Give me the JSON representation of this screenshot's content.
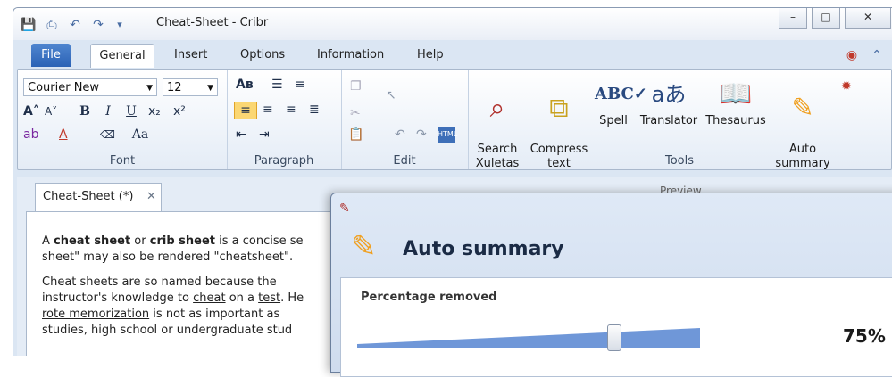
{
  "window": {
    "title": "Cheat-Sheet - Cribr"
  },
  "quick_access": [
    "save-icon",
    "print-icon",
    "undo-icon",
    "redo-icon",
    "customize-icon"
  ],
  "ribbon_tabs": {
    "file": "File",
    "general": "General",
    "insert": "Insert",
    "options": "Options",
    "information": "Information",
    "help": "Help"
  },
  "ribbon": {
    "font": {
      "family": "Courier New",
      "size": "12",
      "label": "Font",
      "bold": "B",
      "italic": "I",
      "underline": "U",
      "case": "Aa"
    },
    "paragraph": {
      "label": "Paragraph"
    },
    "edit": {
      "label": "Edit"
    },
    "tools": {
      "label": "Tools",
      "search_xuletas": "Search\nXuletas",
      "compress_text": "Compress\ntext",
      "spell": "Spell",
      "translator": "Translator",
      "thesaurus": "Thesaurus",
      "auto_summary": "Auto\nsummary"
    }
  },
  "document_tab": {
    "label": "Cheat-Sheet (*)"
  },
  "preview": {
    "label": "Preview"
  },
  "document": {
    "p1_a": "A ",
    "p1_b": "cheat sheet",
    "p1_c": " or ",
    "p1_d": "crib sheet",
    "p1_e": " is a concise se",
    "p1_line2": "sheet\" may also be rendered \"cheatsheet\".",
    "p2_line1": "Cheat sheets are so named because the",
    "p2_line2_a": "instructor's knowledge to ",
    "p2_line2_b": "cheat",
    "p2_line2_c": " on a ",
    "p2_line2_d": "test",
    "p2_line2_e": ". He",
    "p2_line3_a": "rote memorization",
    "p2_line3_b": " is not as important as",
    "p2_line4": "studies, high school or undergraduate stud"
  },
  "dialog": {
    "title": "Auto summary",
    "percentage_label": "Percentage removed",
    "percentage_value": "75%",
    "percentage": 75,
    "slider_fill_color": "#6f97d8"
  }
}
